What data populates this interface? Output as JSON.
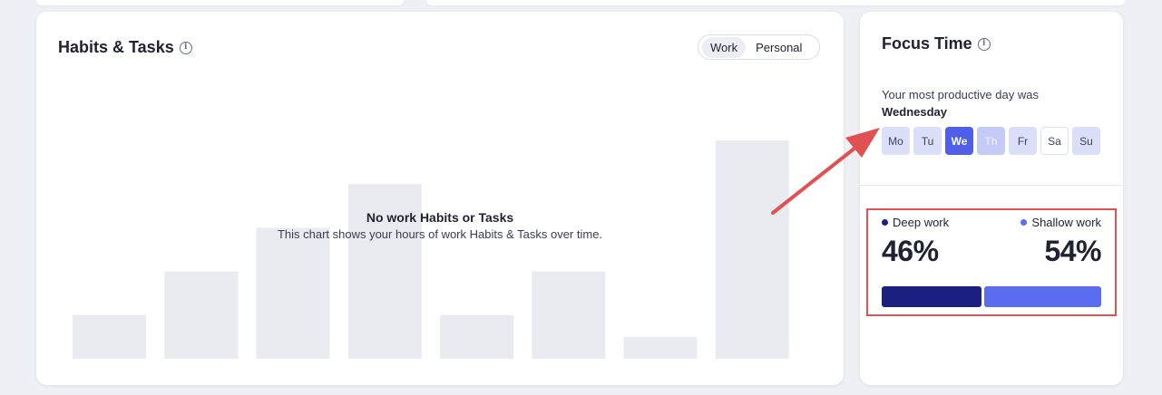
{
  "habits": {
    "title": "Habits & Tasks",
    "toggle": {
      "options": [
        {
          "label": "Work",
          "active": true
        },
        {
          "label": "Personal",
          "active": false
        }
      ]
    },
    "empty_title": "No work Habits or Tasks",
    "empty_subtitle": "This chart shows your hours of work Habits & Tasks over time.",
    "placeholder_bars": [
      0.2,
      0.4,
      0.6,
      0.8,
      0.2,
      0.4,
      0.1,
      1.0
    ],
    "bar_color": "#e9ebf0"
  },
  "focus": {
    "title": "Focus Time",
    "productive_text": "Your most productive day was",
    "productive_day": "Wednesday",
    "days": [
      {
        "label": "Mo",
        "state": "medium"
      },
      {
        "label": "Tu",
        "state": "medium"
      },
      {
        "label": "We",
        "state": "selected"
      },
      {
        "label": "Th",
        "state": "light"
      },
      {
        "label": "Fr",
        "state": "medium"
      },
      {
        "label": "Sa",
        "state": "empty"
      },
      {
        "label": "Su",
        "state": "medium"
      }
    ],
    "deep_label": "Deep work",
    "shallow_label": "Shallow work",
    "deep_pct": "46%",
    "shallow_pct": "54%",
    "deep_fraction": 0.46,
    "deep_color": "#1a2080",
    "shallow_color": "#5a6cf0",
    "highlight_color": "#e05252"
  }
}
